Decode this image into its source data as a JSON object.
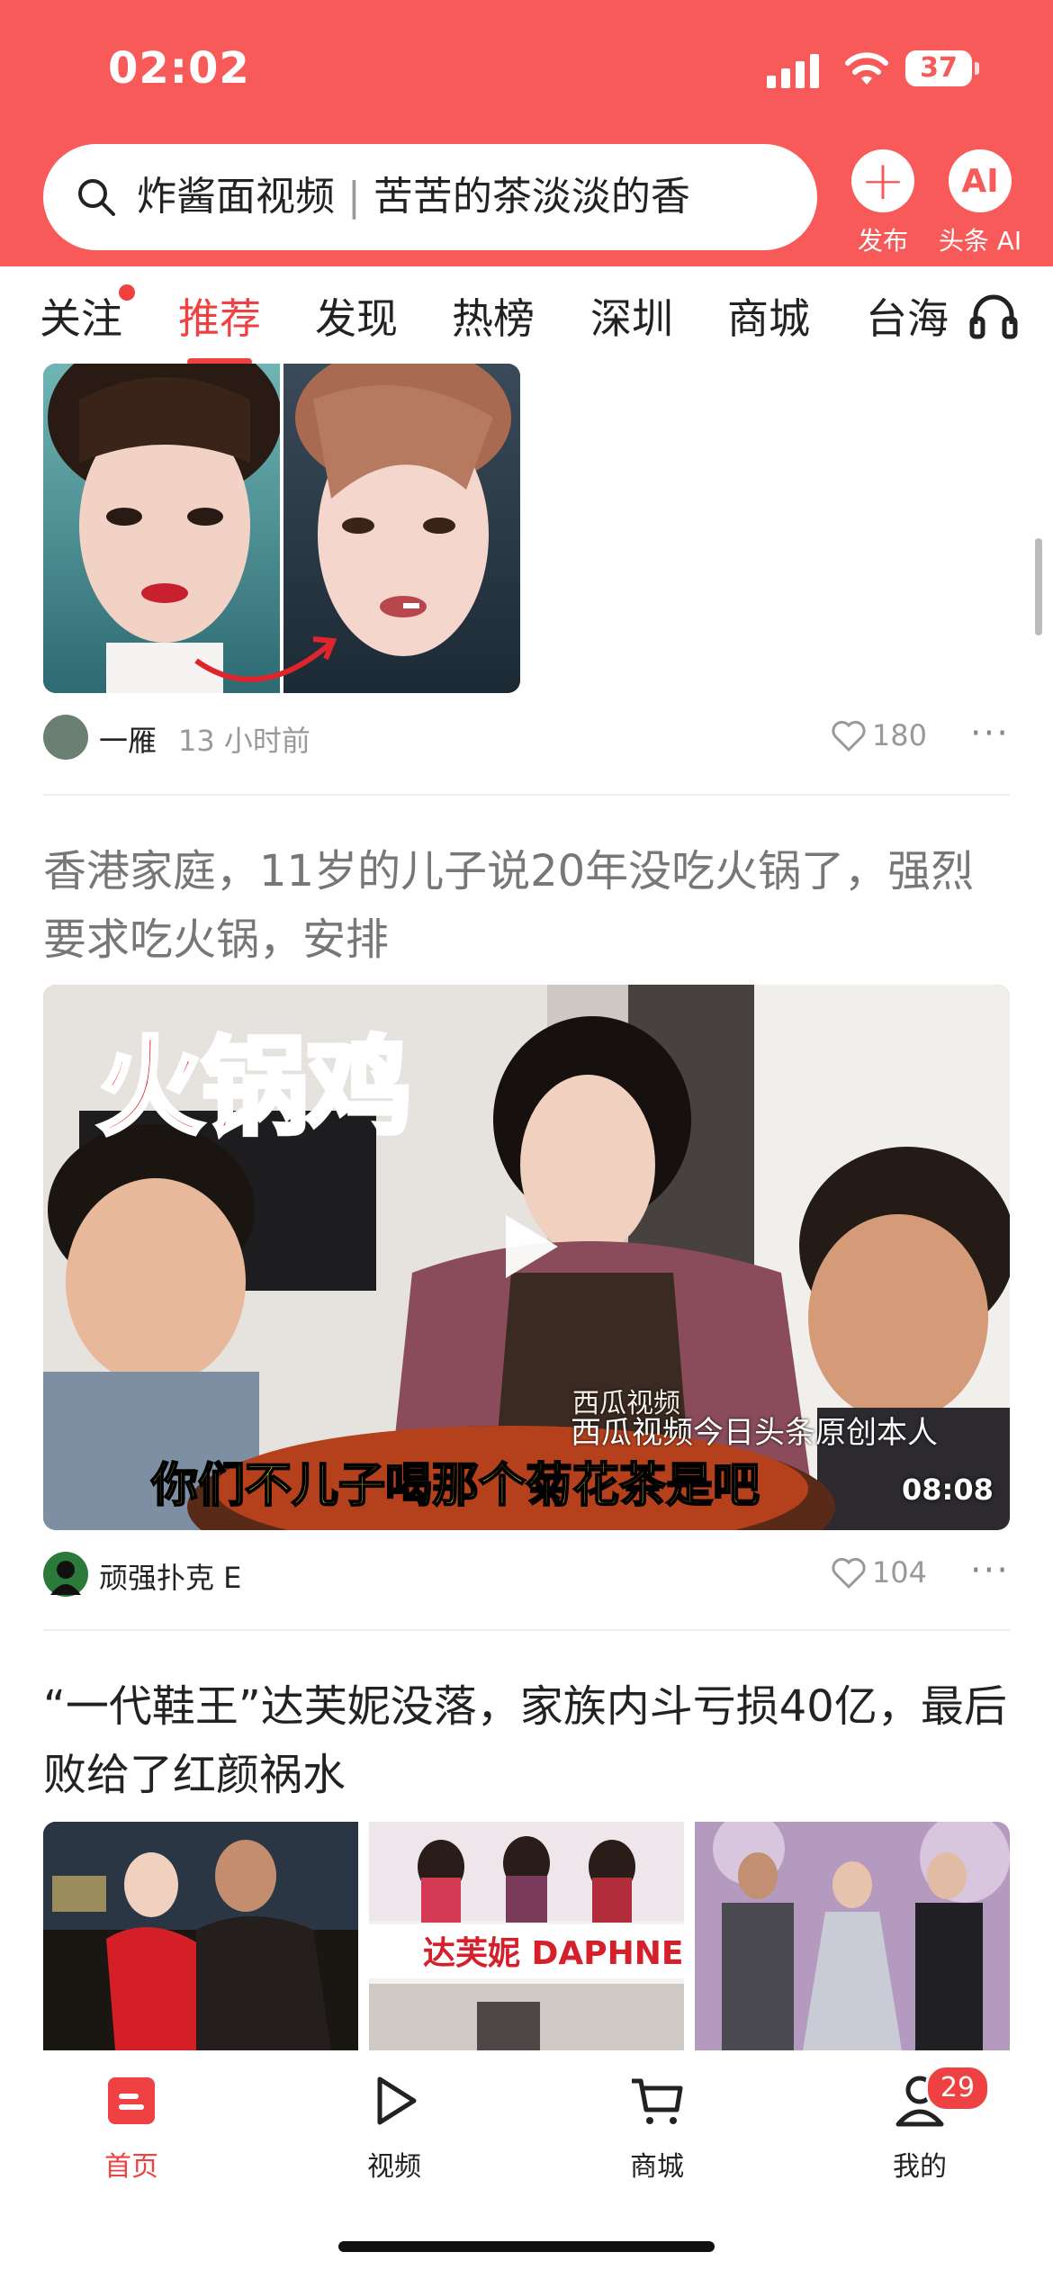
{
  "status_bar": {
    "time": "02:02",
    "battery": "37"
  },
  "search": {
    "text_left": "炸酱面视频",
    "separator": "|",
    "text_right": "苦苦的茶淡淡的香"
  },
  "header_buttons": {
    "publish_label": "发布",
    "ai_label": "头条 AI",
    "ai_glyph": "AI"
  },
  "tabs": [
    {
      "label": "关注",
      "has_dot": true
    },
    {
      "label": "推荐",
      "active": true
    },
    {
      "label": "发现"
    },
    {
      "label": "热榜"
    },
    {
      "label": "深圳"
    },
    {
      "label": "商城"
    },
    {
      "label": "台海"
    }
  ],
  "feed": [
    {
      "type": "image-post",
      "author": "一雁",
      "time": "13 小时前",
      "likes": "180"
    },
    {
      "type": "video",
      "title": "香港家庭，11岁的儿子说20年没吃火锅了，强烈要求吃火锅，安排",
      "read": true,
      "overlay_text": "火锅鸡",
      "caption": "西瓜视频今日头条原创本人",
      "subtitle": "你们不儿子喝那个菊花茶是吧",
      "duration": "08:08",
      "apron_text": "西瓜视频",
      "author": "顽强扑克 E",
      "likes": "104"
    },
    {
      "type": "three-images",
      "title": "“一代鞋王”达芙妮没落，家族内斗亏损40亿，最后败给了红颜祸水",
      "sign_text": "达芙妮 DAPHNE"
    }
  ],
  "bottom_nav": [
    {
      "label": "首页",
      "icon": "home-icon",
      "active": true
    },
    {
      "label": "视频",
      "icon": "play-icon"
    },
    {
      "label": "商城",
      "icon": "cart-icon"
    },
    {
      "label": "我的",
      "icon": "person-icon",
      "badge": "29"
    }
  ],
  "colors": {
    "brand": "#f85959",
    "accent": "#f04142",
    "muted": "#999999"
  }
}
